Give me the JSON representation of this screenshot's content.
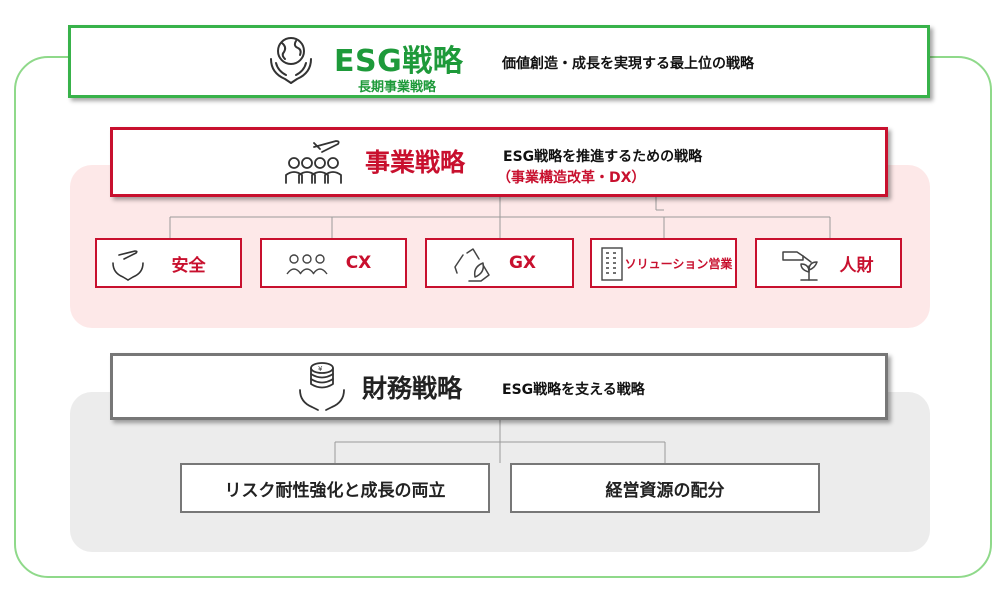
{
  "esg": {
    "title": "ESG戦略",
    "subtitle": "長期事業戦略",
    "description": "価値創造・成長を実現する最上位の戦略"
  },
  "business": {
    "title": "事業戦略",
    "description": "ESG戦略を推進するための戦略",
    "note": "（事業構造改革・DX）",
    "items": [
      {
        "label": "安全",
        "icon": "hands-plane-icon"
      },
      {
        "label": "CX",
        "icon": "people-icon"
      },
      {
        "label": "GX",
        "icon": "recycle-leaf-icon"
      },
      {
        "label": "ソリューション営業",
        "icon": "building-icon"
      },
      {
        "label": "人財",
        "icon": "watering-plant-icon"
      }
    ]
  },
  "finance": {
    "title": "財務戦略",
    "description": "ESG戦略を支える戦略",
    "items": [
      {
        "label": "リスク耐性強化と成長の両立"
      },
      {
        "label": "経営資源の配分"
      }
    ]
  },
  "colors": {
    "esg_green": "#1e9a3a",
    "business_red": "#c8102e",
    "finance_gray": "#777777",
    "outer_border": "#8fd98a"
  }
}
